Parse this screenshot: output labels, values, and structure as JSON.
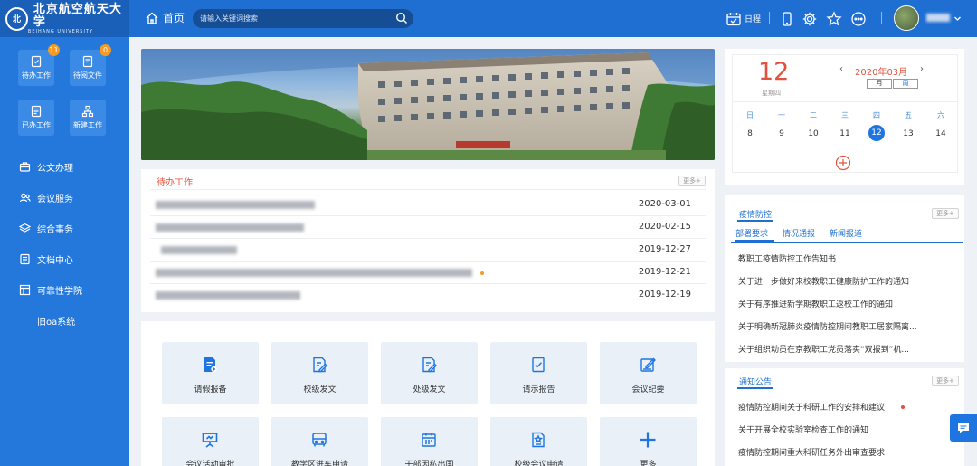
{
  "app": {
    "logo_cn": "北京航空航天大学",
    "logo_en": "BEIHANG UNIVERSITY",
    "home_label": "首页",
    "search_placeholder": "请输入关键词搜索",
    "schedule_label": "日程"
  },
  "sidebar": {
    "tiles": [
      {
        "label": "待办工作",
        "badge": "11",
        "icon": "todo-icon"
      },
      {
        "label": "待阅文件",
        "badge": "0",
        "icon": "edit-doc-icon"
      },
      {
        "label": "已办工作",
        "icon": "done-doc-icon"
      },
      {
        "label": "新建工作",
        "icon": "org-chart-icon"
      }
    ],
    "items": [
      {
        "label": "公文办理",
        "icon": "briefcase-icon"
      },
      {
        "label": "会议服务",
        "icon": "people-icon"
      },
      {
        "label": "综合事务",
        "icon": "layers-icon"
      },
      {
        "label": "文档中心",
        "icon": "document-icon"
      },
      {
        "label": "可靠性学院",
        "icon": "building-icon"
      },
      {
        "label": "旧oa系统",
        "icon": ""
      }
    ]
  },
  "todo": {
    "title": "待办工作",
    "more_label": "更多+",
    "rows": [
      {
        "date": "2020-03-01"
      },
      {
        "date": "2020-02-15"
      },
      {
        "date": "2019-12-27"
      },
      {
        "date": "2019-12-21"
      },
      {
        "date": "2019-12-19"
      }
    ]
  },
  "quick_actions": [
    {
      "label": "请假报备",
      "icon": "leave-request-icon"
    },
    {
      "label": "校级发文",
      "icon": "edit-doc-icon"
    },
    {
      "label": "处级发文",
      "icon": "edit-doc-icon"
    },
    {
      "label": "请示报告",
      "icon": "check-doc-icon"
    },
    {
      "label": "会议纪要",
      "icon": "edit-note-icon"
    },
    {
      "label": "会议活动审批",
      "icon": "presentation-icon"
    },
    {
      "label": "教学区进车申请",
      "icon": "bus-icon"
    },
    {
      "label": "干部因私出国",
      "icon": "calendar-icon"
    },
    {
      "label": "校级会议申请",
      "icon": "star-doc-icon"
    },
    {
      "label": "更多",
      "icon": "plus-icon"
    }
  ],
  "calendar": {
    "day": "12",
    "weekday": "星期四",
    "month_label": "2020年03月",
    "view_month": "月",
    "view_week": "周",
    "weekdays": [
      "日",
      "一",
      "二",
      "三",
      "四",
      "五",
      "六"
    ],
    "dates": [
      "8",
      "9",
      "10",
      "11",
      "12",
      "13",
      "14"
    ],
    "today": "12"
  },
  "epidemic": {
    "title": "疫情防控",
    "more_label": "更多+",
    "tabs": [
      "部署要求",
      "情况通报",
      "新闻报道"
    ],
    "items": [
      "教职工疫情防控工作告知书",
      "关于进一步做好来校教职工健康防护工作的通知",
      "关于有序推进新学期教职工返校工作的通知",
      "关于明确新冠肺炎疫情防控期间教职工居家隔离...",
      "关于组织动员在京教职工党员落实“双报到”机..."
    ]
  },
  "notices": {
    "title": "通知公告",
    "more_label": "更多+",
    "items": [
      "疫情防控期间关于科研工作的安排和建议",
      "关于开展全校实验室检查工作的通知",
      "疫情防控期间重大科研任务外出审查要求"
    ]
  },
  "colors": {
    "topbar": "#1f6fd3",
    "sidebar": "#2478dc",
    "accent_red": "#e2513d",
    "badge": "#f59a23"
  }
}
